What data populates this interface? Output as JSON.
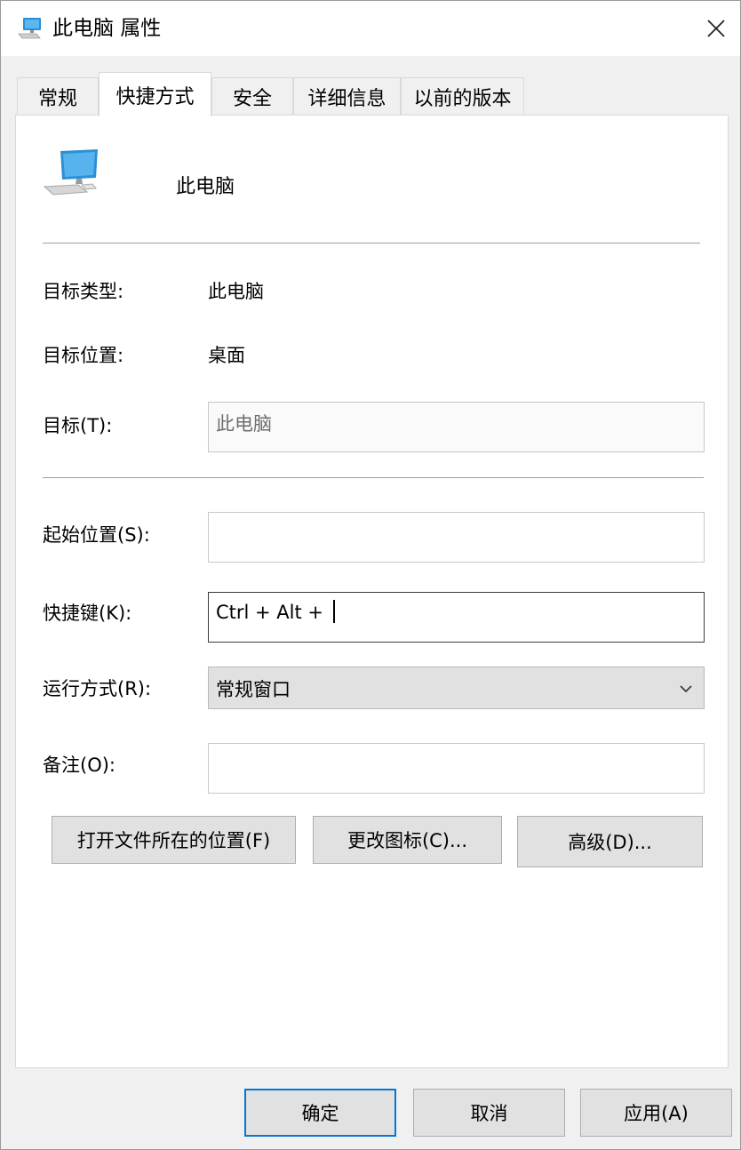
{
  "window": {
    "title": "此电脑 属性",
    "close_glyph": "✕"
  },
  "tabs": [
    {
      "label": "常规",
      "active": false
    },
    {
      "label": "快捷方式",
      "active": true
    },
    {
      "label": "安全",
      "active": false
    },
    {
      "label": "详细信息",
      "active": false
    },
    {
      "label": "以前的版本",
      "active": false
    }
  ],
  "shortcut": {
    "name": "此电脑",
    "icon": "computer-icon",
    "target_type_label": "目标类型:",
    "target_type_value": "此电脑",
    "target_location_label": "目标位置:",
    "target_location_value": "桌面",
    "target_label": "目标(T):",
    "target_value": "此电脑",
    "start_in_label": "起始位置(S):",
    "start_in_value": "",
    "hotkey_label": "快捷键(K):",
    "hotkey_value": "Ctrl + Alt + ",
    "run_label": "运行方式(R):",
    "run_value": "常规窗口",
    "comment_label": "备注(O):",
    "comment_value": ""
  },
  "actions": {
    "open_location": "打开文件所在的位置(F)",
    "change_icon": "更改图标(C)...",
    "advanced": "高级(D)..."
  },
  "footer": {
    "ok": "确定",
    "cancel": "取消",
    "apply": "应用(A)"
  },
  "colors": {
    "accent": "#0078d7",
    "monitor": "#2b8fd6"
  }
}
